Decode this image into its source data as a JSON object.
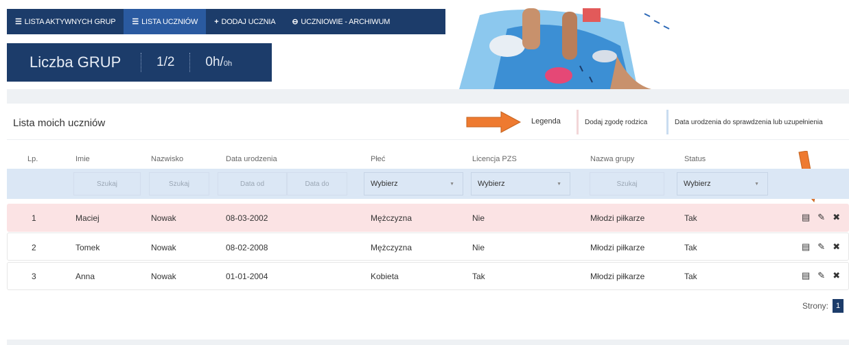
{
  "nav": [
    {
      "icon": "list-icon",
      "glyph": "☰",
      "label": "LISTA AKTYWNYCH GRUP",
      "active": false
    },
    {
      "icon": "list-icon",
      "glyph": "☰",
      "label": "LISTA UCZNIÓW",
      "active": true
    },
    {
      "icon": "plus-icon",
      "glyph": "+",
      "label": "DODAJ UCZNIA",
      "active": false
    },
    {
      "icon": "archive-icon",
      "glyph": "⊖",
      "label": "UCZNIOWIE - ARCHIWUM",
      "active": false
    }
  ],
  "counter": {
    "label": "Liczba GRUP",
    "groups": "1/2",
    "hours": "0h/",
    "hours_small": "0h"
  },
  "panel": {
    "title": "Lista moich uczniów",
    "legend_label": "Legenda",
    "legend_red": "Dodaj zgodę rodzica",
    "legend_blue": "Data urodzenia do sprawdzenia lub uzupełnienia"
  },
  "columns": [
    "Lp.",
    "Imie",
    "Nazwisko",
    "Data urodzenia",
    "Płeć",
    "Licencja PZS",
    "Nazwa grupy",
    "Status"
  ],
  "filters": {
    "imie": "Szukaj",
    "nazwisko": "Szukaj",
    "date_from": "Data od",
    "date_to": "Data do",
    "plec": "Wybierz",
    "licencja": "Wybierz",
    "grupa": "Szukaj",
    "status": "Wybierz"
  },
  "rows": [
    {
      "lp": "1",
      "imie": "Maciej",
      "nazwisko": "Nowak",
      "data": "08-03-2002",
      "plec": "Mężczyzna",
      "licencja": "Nie",
      "grupa": "Młodzi piłkarze",
      "status": "Tak"
    },
    {
      "lp": "2",
      "imie": "Tomek",
      "nazwisko": "Nowak",
      "data": "08-02-2008",
      "plec": "Mężczyzna",
      "licencja": "Nie",
      "grupa": "Młodzi piłkarze",
      "status": "Tak"
    },
    {
      "lp": "3",
      "imie": "Anna",
      "nazwisko": "Nowak",
      "data": "01-01-2004",
      "plec": "Kobieta",
      "licencja": "Tak",
      "grupa": "Młodzi piłkarze",
      "status": "Tak"
    }
  ],
  "actions": {
    "details": "▤",
    "edit": "✎",
    "delete": "✖"
  },
  "pagination": {
    "label": "Strony:",
    "current": "1"
  },
  "colors": {
    "nav_bg": "#1c3c6a",
    "nav_active": "#2a5aa0",
    "row_highlight": "#fbe3e4",
    "filter_bg": "#dbe7f5",
    "arrow": "#ee7a30"
  }
}
